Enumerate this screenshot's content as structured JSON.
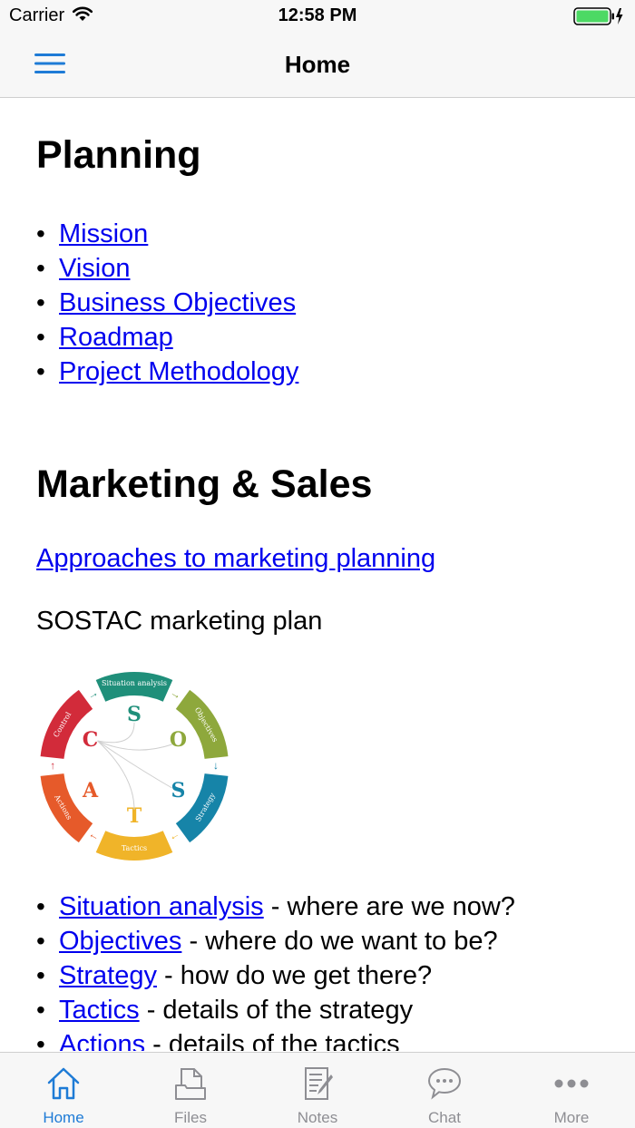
{
  "status_bar": {
    "carrier": "Carrier",
    "time": "12:58 PM",
    "wifi_icon": "wifi-icon",
    "battery_icon": "battery-charging-icon",
    "battery_level": 1.0
  },
  "nav": {
    "title": "Home",
    "menu_icon": "hamburger-menu-icon"
  },
  "planning": {
    "heading": "Planning",
    "links": [
      "Mission",
      "Vision",
      "Business Objectives",
      "Roadmap",
      "Project Methodology"
    ]
  },
  "marketing": {
    "heading": "Marketing & Sales",
    "approaches_link": "Approaches to marketing planning",
    "sostac_label": "SOSTAC marketing plan",
    "diagram": {
      "letters": [
        "S",
        "O",
        "S",
        "T",
        "A",
        "C"
      ],
      "segments": [
        "Situation analysis",
        "Objectives",
        "Strategy",
        "Tactics",
        "Actions",
        "Control"
      ],
      "colors": [
        "#1f8f7a",
        "#8ea83c",
        "#1684a8",
        "#f0b429",
        "#e65a2a",
        "#d22b3a"
      ]
    },
    "items": [
      {
        "link": "Situation analysis",
        "desc": " - where are we now?"
      },
      {
        "link": "Objectives",
        "desc": " - where do we want to be?"
      },
      {
        "link": "Strategy",
        "desc": " - how do we get there?"
      },
      {
        "link": "Tactics",
        "desc": " - details of the strategy"
      },
      {
        "link": "Actions",
        "desc": " - details of the tactics"
      }
    ]
  },
  "tabs": [
    {
      "label": "Home",
      "icon": "home-icon",
      "active": true
    },
    {
      "label": "Files",
      "icon": "files-icon",
      "active": false
    },
    {
      "label": "Notes",
      "icon": "notes-icon",
      "active": false
    },
    {
      "label": "Chat",
      "icon": "chat-icon",
      "active": false
    },
    {
      "label": "More",
      "icon": "more-icon",
      "active": false
    }
  ],
  "colors": {
    "link": "#0000ee",
    "tab_active": "#1e7bd6",
    "tab_inactive": "#8e8e93",
    "battery": "#4cd964"
  }
}
